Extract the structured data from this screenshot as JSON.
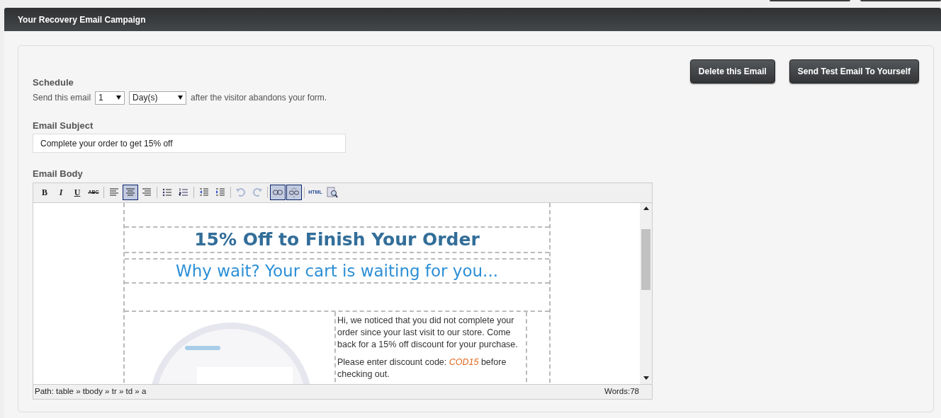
{
  "top_buttons": [
    {
      "kind": "cut"
    },
    {
      "kind": "cut"
    }
  ],
  "panel": {
    "title": "Your Recovery Email Campaign"
  },
  "actions": [
    "Delete this Email",
    "Send Test Email To Yourself"
  ],
  "schedule": {
    "heading": "Schedule",
    "lead": "Send this email",
    "amount": "1",
    "unit": "Day(s)",
    "trail": "after the visitor abandons your form."
  },
  "subject": {
    "label": "Email Subject",
    "value": "Complete your order to get 15% off"
  },
  "body": {
    "label": "Email Body",
    "toolbar": [
      {
        "kind": "bold",
        "label": "B",
        "active": false,
        "disabled": false
      },
      {
        "kind": "italic",
        "label": "I",
        "active": false,
        "disabled": false
      },
      {
        "kind": "underline",
        "label": "U",
        "active": false,
        "disabled": false
      },
      {
        "kind": "strike",
        "label": "ABC",
        "active": false,
        "disabled": false
      },
      {
        "kind": "sep"
      },
      {
        "kind": "align-left",
        "active": false,
        "disabled": false
      },
      {
        "kind": "align-center",
        "active": true,
        "disabled": false
      },
      {
        "kind": "align-right",
        "active": false,
        "disabled": false
      },
      {
        "kind": "sep"
      },
      {
        "kind": "bullets",
        "active": false,
        "disabled": false
      },
      {
        "kind": "numbers",
        "active": false,
        "disabled": false
      },
      {
        "kind": "sep"
      },
      {
        "kind": "outdent",
        "active": false,
        "disabled": false
      },
      {
        "kind": "indent",
        "active": false,
        "disabled": false
      },
      {
        "kind": "sep"
      },
      {
        "kind": "undo",
        "active": false,
        "disabled": true
      },
      {
        "kind": "redo",
        "active": false,
        "disabled": true
      },
      {
        "kind": "sep"
      },
      {
        "kind": "link",
        "active": true,
        "disabled": false
      },
      {
        "kind": "unlink",
        "active": true,
        "disabled": false
      },
      {
        "kind": "sep"
      },
      {
        "kind": "html",
        "label": "HTML",
        "active": false,
        "disabled": false
      },
      {
        "kind": "preview",
        "active": false,
        "disabled": false
      }
    ],
    "content": {
      "title": "15% Off to Finish Your Order",
      "subtitle": "Why wait? Your cart is waiting for you...",
      "paragraphs": [
        "Hi, we noticed that you did not complete your order since your last visit to our store. Come back for a 15% off discount for your purchase.",
        "Please enter discount code: *COD15* before checking out."
      ]
    },
    "path": "Path: table » tbody » tr » td » a",
    "words": "Words:78"
  }
}
